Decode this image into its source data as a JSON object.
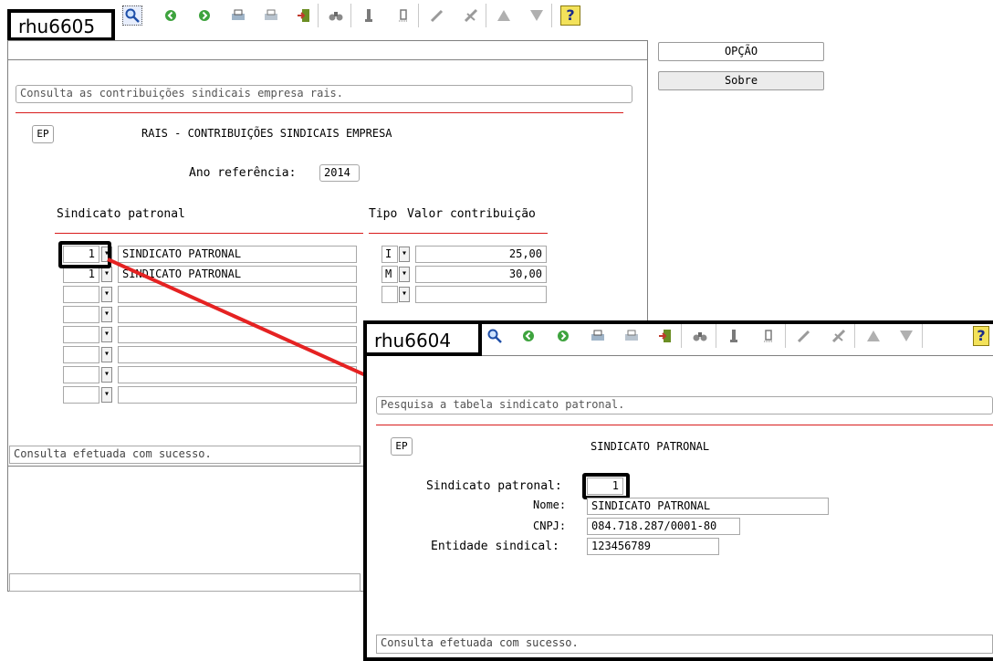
{
  "win1": {
    "label": "rhu6605",
    "description": "Consulta as contribuições sindicais empresa rais.",
    "ep": "EP",
    "title": "RAIS - CONTRIBUIÇÕES SINDICAIS EMPRESA",
    "ano_label": "Ano referência:",
    "ano_value": "2014",
    "col_sindicato": "Sindicato patronal",
    "col_tipo": "Tipo",
    "col_valor": "Valor contribuição",
    "rows": [
      {
        "code": "1",
        "name": "SINDICATO PATRONAL",
        "tipo": "I",
        "valor": "25,00"
      },
      {
        "code": "1",
        "name": "SINDICATO PATRONAL",
        "tipo": "M",
        "valor": "30,00"
      },
      {
        "code": "",
        "name": "",
        "tipo": "",
        "valor": ""
      },
      {
        "code": "",
        "name": "",
        "tipo": "",
        "valor": ""
      },
      {
        "code": "",
        "name": "",
        "tipo": "",
        "valor": ""
      },
      {
        "code": "",
        "name": "",
        "tipo": "",
        "valor": ""
      },
      {
        "code": "",
        "name": "",
        "tipo": "",
        "valor": ""
      },
      {
        "code": "",
        "name": "",
        "tipo": "",
        "valor": ""
      }
    ],
    "status": "Consulta efetuada com sucesso."
  },
  "side": {
    "opcao": "OPÇÃO",
    "sobre": "Sobre"
  },
  "win2": {
    "label": "rhu6604",
    "description": "Pesquisa a tabela sindicato patronal.",
    "ep": "EP",
    "title": "SINDICATO PATRONAL",
    "sindicato_label": "Sindicato patronal:",
    "sindicato_value": "1",
    "nome_label": "Nome:",
    "nome_value": "SINDICATO PATRONAL",
    "cnpj_label": "CNPJ:",
    "cnpj_value": "084.718.287/0001-80",
    "entidade_label": "Entidade sindical:",
    "entidade_value": "123456789",
    "status": "Consulta efetuada com sucesso."
  },
  "toolbar_icons": [
    "search-icon",
    "back-icon",
    "forward-icon",
    "print-icon",
    "print-preview-icon",
    "exit-icon",
    "binoculars-icon",
    "first-record-icon",
    "last-record-icon",
    "edit-icon",
    "cancel-icon",
    "up-icon",
    "down-icon",
    "help-icon"
  ],
  "colors": {
    "accent_red": "#d81c1c",
    "connector": "#e52222"
  }
}
